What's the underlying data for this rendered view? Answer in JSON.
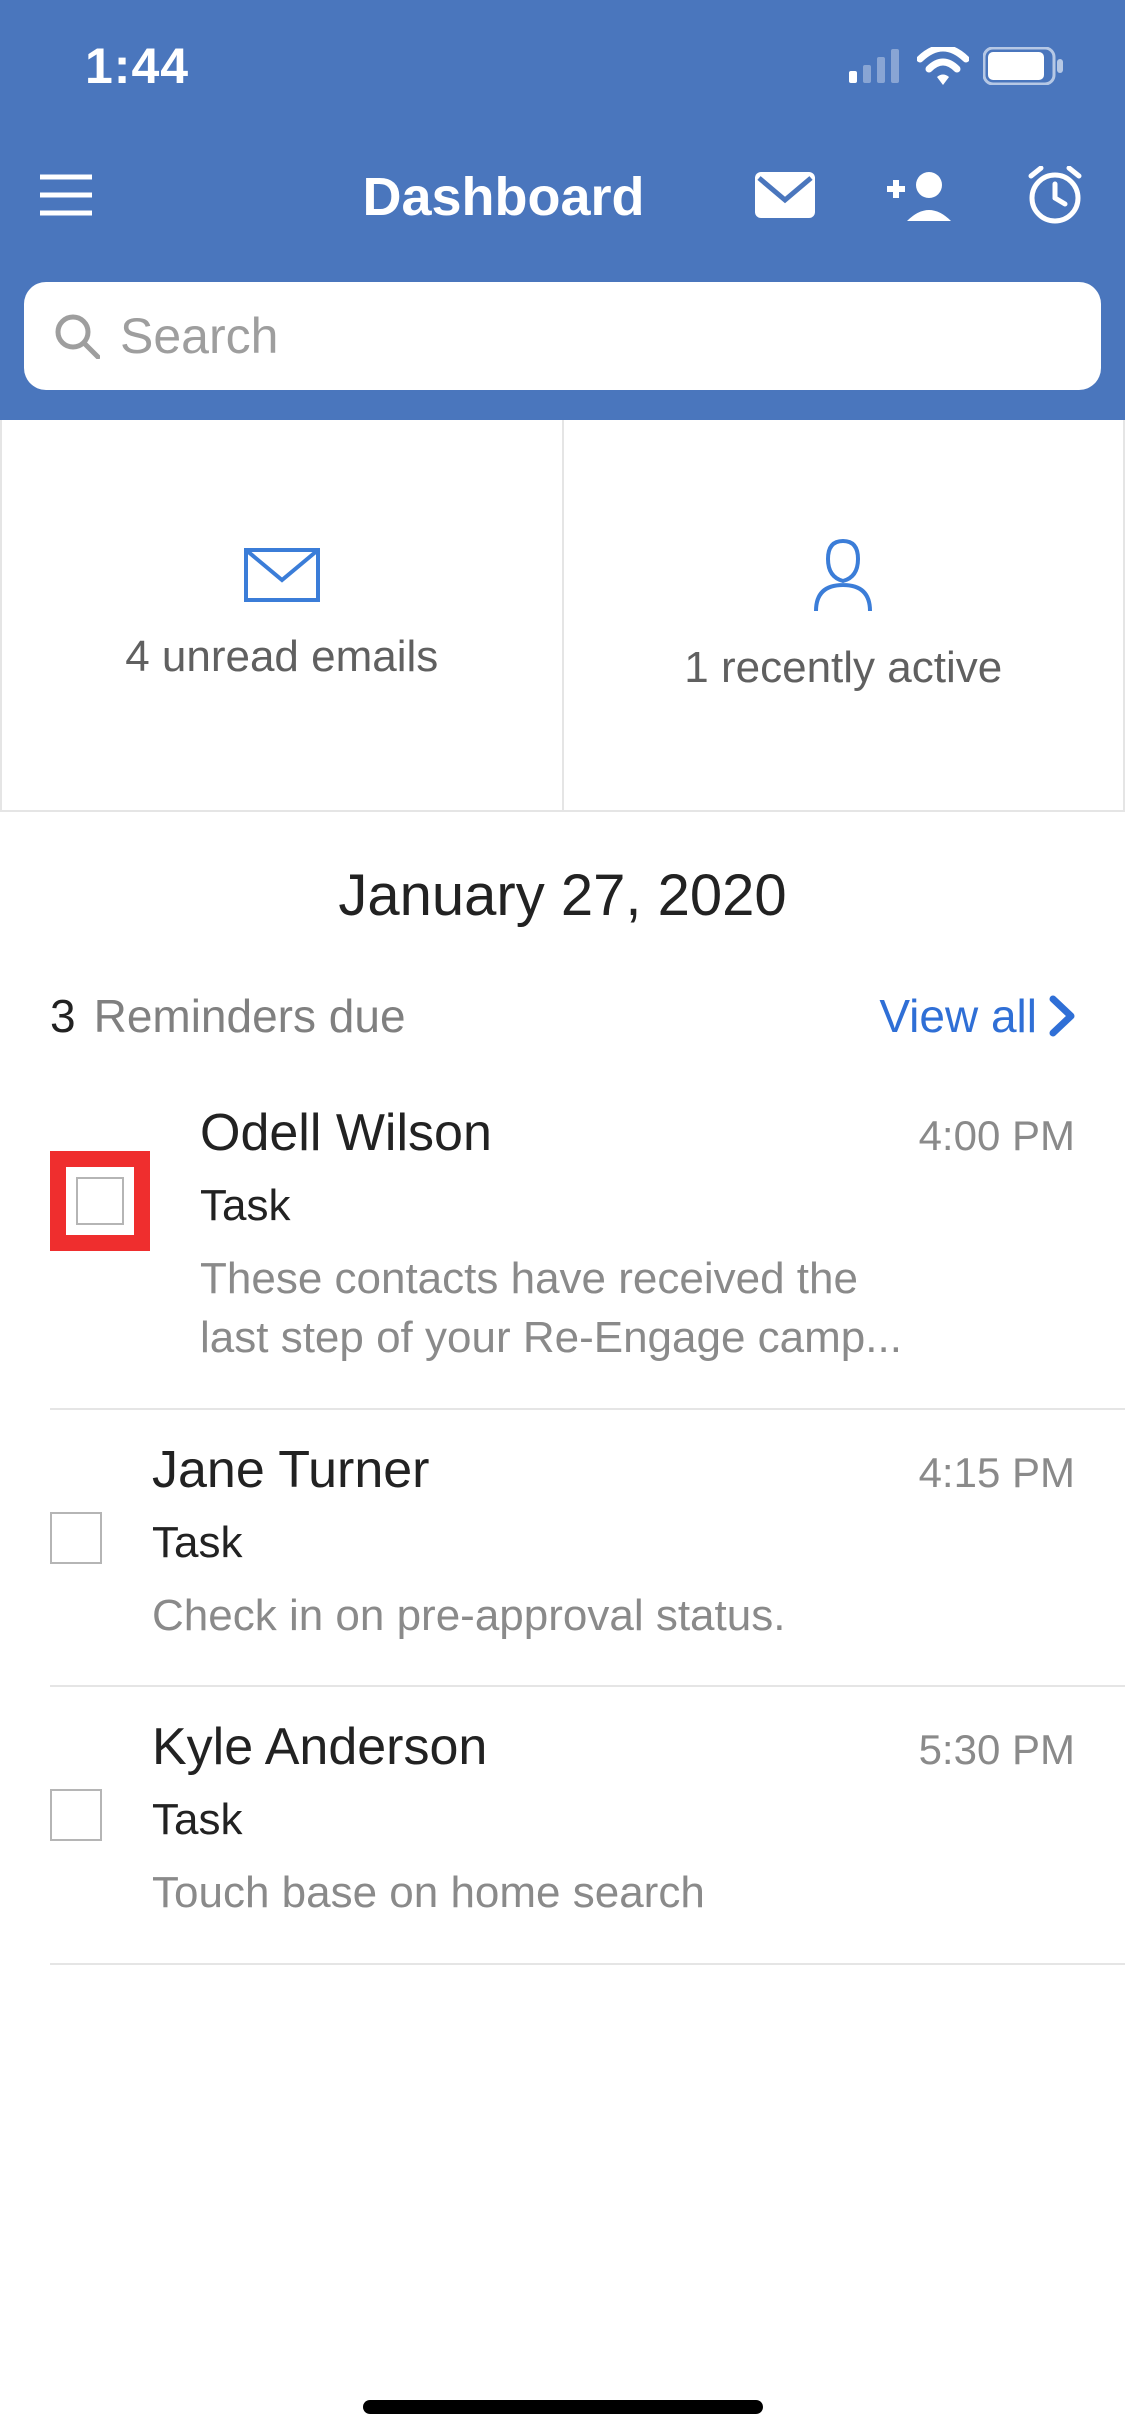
{
  "status": {
    "time": "1:44"
  },
  "header": {
    "title": "Dashboard"
  },
  "search": {
    "placeholder": "Search"
  },
  "stats": {
    "emails": "4 unread emails",
    "active": "1 recently active"
  },
  "date": "January 27, 2020",
  "reminders": {
    "count": "3",
    "label": "Reminders due",
    "view_all": "View all"
  },
  "items": [
    {
      "name": "Odell Wilson",
      "time": "4:00 PM",
      "type": "Task",
      "desc": "These contacts have received the last step of your Re-Engage camp..."
    },
    {
      "name": "Jane Turner",
      "time": "4:15 PM",
      "type": "Task",
      "desc": "Check in on pre-approval status."
    },
    {
      "name": "Kyle Anderson",
      "time": "5:30 PM",
      "type": "Task",
      "desc": "Touch base on home search"
    }
  ]
}
